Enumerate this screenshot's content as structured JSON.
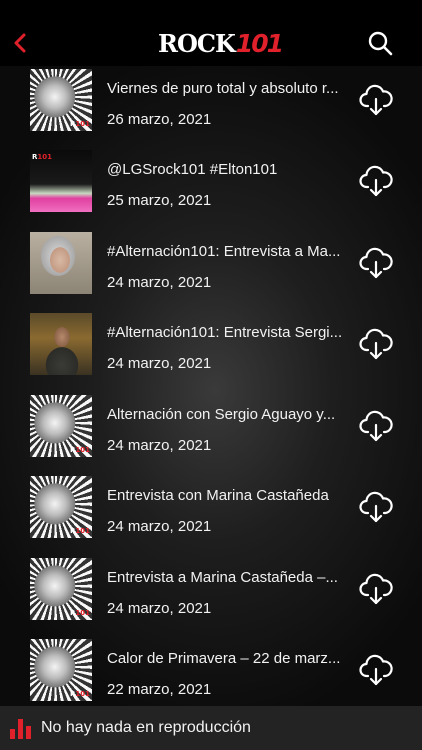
{
  "header": {
    "back_icon": "chevron-left-icon",
    "logo_word": "ROCK",
    "logo_number": "101",
    "search_icon": "search-icon",
    "accent_color": "#e0202a"
  },
  "episodes": [
    {
      "title": "Viernes de puro total y absoluto r...",
      "date": "26 marzo, 2021",
      "thumb": "disco-ball"
    },
    {
      "title": "@LGSrock101 #Elton101",
      "date": "25 marzo, 2021",
      "thumb": "elton"
    },
    {
      "title": "#Alternación101: Entrevista a Ma...",
      "date": "24 marzo, 2021",
      "thumb": "portrait-woman"
    },
    {
      "title": "#Alternación101: Entrevista Sergi...",
      "date": "24 marzo, 2021",
      "thumb": "portrait-man"
    },
    {
      "title": "Alternación con Sergio Aguayo y...",
      "date": "24 marzo, 2021",
      "thumb": "disco-ball"
    },
    {
      "title": "Entrevista con Marina Castañeda",
      "date": "24 marzo, 2021",
      "thumb": "disco-ball"
    },
    {
      "title": "Entrevista a Marina Castañeda –...",
      "date": "24 marzo, 2021",
      "thumb": "disco-ball"
    },
    {
      "title": "Calor de Primavera – 22 de marz...",
      "date": "22 marzo, 2021",
      "thumb": "disco-ball"
    }
  ],
  "download_icon": "cloud-download-icon",
  "player": {
    "status_text": "No hay nada en reproducción",
    "icon": "equalizer-icon"
  }
}
